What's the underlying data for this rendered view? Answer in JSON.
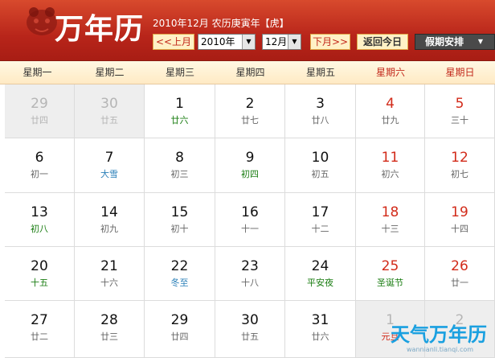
{
  "header": {
    "logo_text": "万年历",
    "lunar_title": "2010年12月 农历庚寅年【虎】",
    "prev_label": "<<上月",
    "year_value": "2010年",
    "month_value": "12月",
    "next_label": "下月>>",
    "today_label": "返回今日",
    "holiday_label": "假期安排",
    "arrow_glyph": "▼",
    "colors": {
      "header_red": "#b8251a",
      "button_bg": "#fff1c6",
      "accent_red": "#c2281b"
    }
  },
  "weekdays": [
    "星期一",
    "星期二",
    "星期三",
    "星期四",
    "星期五",
    "星期六",
    "星期日"
  ],
  "weeks": [
    [
      {
        "day": "29",
        "lunar": "廿四",
        "other": true
      },
      {
        "day": "30",
        "lunar": "廿五",
        "other": true
      },
      {
        "day": "1",
        "lunar": "廿六",
        "lunar_color": "green"
      },
      {
        "day": "2",
        "lunar": "廿七"
      },
      {
        "day": "3",
        "lunar": "廿八"
      },
      {
        "day": "4",
        "lunar": "廿九",
        "weekend": true
      },
      {
        "day": "5",
        "lunar": "三十",
        "weekend": true
      }
    ],
    [
      {
        "day": "6",
        "lunar": "初一"
      },
      {
        "day": "7",
        "lunar": "大雪",
        "lunar_color": "blue"
      },
      {
        "day": "8",
        "lunar": "初三"
      },
      {
        "day": "9",
        "lunar": "初四",
        "lunar_color": "green"
      },
      {
        "day": "10",
        "lunar": "初五"
      },
      {
        "day": "11",
        "lunar": "初六",
        "weekend": true
      },
      {
        "day": "12",
        "lunar": "初七",
        "weekend": true
      }
    ],
    [
      {
        "day": "13",
        "lunar": "初八",
        "lunar_color": "green"
      },
      {
        "day": "14",
        "lunar": "初九"
      },
      {
        "day": "15",
        "lunar": "初十"
      },
      {
        "day": "16",
        "lunar": "十一"
      },
      {
        "day": "17",
        "lunar": "十二"
      },
      {
        "day": "18",
        "lunar": "十三",
        "weekend": true
      },
      {
        "day": "19",
        "lunar": "十四",
        "weekend": true
      }
    ],
    [
      {
        "day": "20",
        "lunar": "十五",
        "lunar_color": "green"
      },
      {
        "day": "21",
        "lunar": "十六"
      },
      {
        "day": "22",
        "lunar": "冬至",
        "lunar_color": "blue"
      },
      {
        "day": "23",
        "lunar": "十八"
      },
      {
        "day": "24",
        "lunar": "平安夜",
        "lunar_color": "green"
      },
      {
        "day": "25",
        "lunar": "圣诞节",
        "weekend": true,
        "lunar_color": "green"
      },
      {
        "day": "26",
        "lunar": "廿一",
        "weekend": true
      }
    ],
    [
      {
        "day": "27",
        "lunar": "廿二"
      },
      {
        "day": "28",
        "lunar": "廿三"
      },
      {
        "day": "29",
        "lunar": "廿四"
      },
      {
        "day": "30",
        "lunar": "廿五"
      },
      {
        "day": "31",
        "lunar": "廿六"
      },
      {
        "day": "1",
        "lunar": "元旦",
        "other": true,
        "lunar_color": "red"
      },
      {
        "day": "2",
        "lunar": "",
        "other": true
      }
    ]
  ],
  "watermark": {
    "title": "天气万年历",
    "subtitle": "wannianli.tianqi.com"
  }
}
